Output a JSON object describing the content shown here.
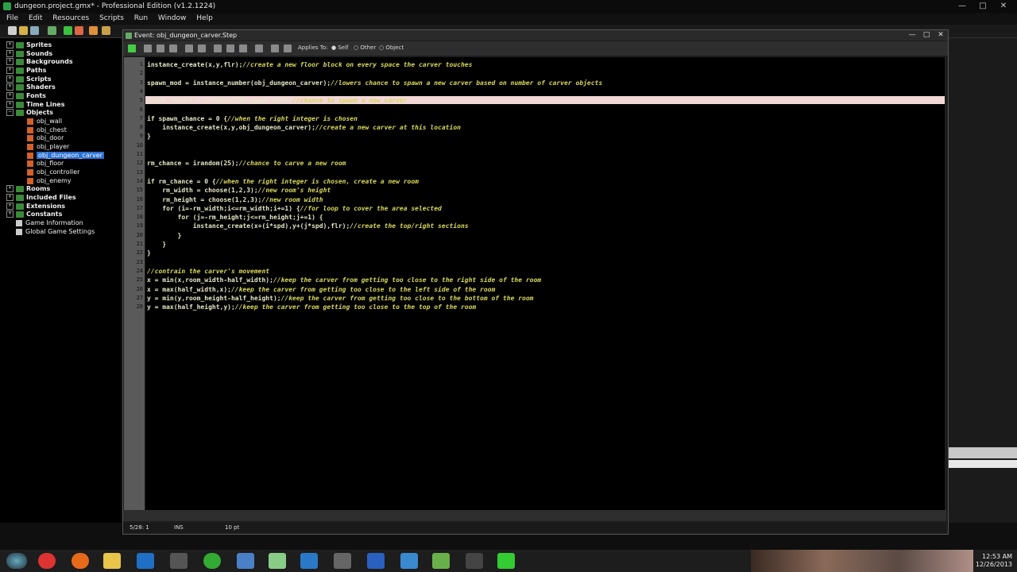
{
  "app": {
    "title": "dungeon.project.gmx* - Professional Edition (v1.2.1224)"
  },
  "menu": [
    "File",
    "Edit",
    "Resources",
    "Scripts",
    "Run",
    "Window",
    "Help"
  ],
  "tree": {
    "groups": [
      {
        "label": "Sprites"
      },
      {
        "label": "Sounds"
      },
      {
        "label": "Backgrounds"
      },
      {
        "label": "Paths"
      },
      {
        "label": "Scripts"
      },
      {
        "label": "Shaders"
      },
      {
        "label": "Fonts"
      },
      {
        "label": "Time Lines"
      },
      {
        "label": "Objects"
      }
    ],
    "objects": [
      "obj_wall",
      "obj_chest",
      "obj_door",
      "obj_player",
      "obj_dungeon_carver",
      "obj_floor",
      "obj_controller",
      "obj_enemy"
    ],
    "groups_after": [
      "Rooms",
      "Included Files",
      "Extensions",
      "Constants"
    ],
    "items_after": [
      "Game Information",
      "Global Game Settings"
    ]
  },
  "editor": {
    "title": "Event: obj_dungeon_carver.Step",
    "applies_label": "Applies To:",
    "opt_self": "Self",
    "opt_other": "Other",
    "opt_object": "Object",
    "status_pos": "5/28: 1",
    "status_mode": "INS",
    "status_font": "10 pt"
  },
  "code": [
    {
      "n": "1",
      "t": "instance_create(x,y,flr);//create a new floor block on every space the carver touches"
    },
    {
      "n": "2",
      "t": ""
    },
    {
      "n": "3",
      "t": "spawn_mod = instance_number(obj_dungeon_carver);//lowers chance to spawn a new carver based on number of carver objects"
    },
    {
      "n": "4",
      "t": ""
    },
    {
      "n": "5",
      "t": "spawn_chance = irandom(100-spawn_mod);//chance to spawn a new carver"
    },
    {
      "n": "6",
      "t": ""
    },
    {
      "n": "7",
      "t": "if spawn_chance = 0 {//when the right integer is chosen"
    },
    {
      "n": "8",
      "t": "    instance_create(x,y,obj_dungeon_carver);//create a new carver at this location"
    },
    {
      "n": "9",
      "t": "}"
    },
    {
      "n": "10",
      "t": ""
    },
    {
      "n": "11",
      "t": ""
    },
    {
      "n": "12",
      "t": "rm_chance = irandom(25);//chance to carve a new room"
    },
    {
      "n": "13",
      "t": ""
    },
    {
      "n": "14",
      "t": "if rm_chance = 0 {//when the right integer is chosen, create a new room"
    },
    {
      "n": "15",
      "t": "    rm_width = choose(1,2,3);//new room's height"
    },
    {
      "n": "16",
      "t": "    rm_height = choose(1,2,3);//new room width"
    },
    {
      "n": "17",
      "t": "    for (i=-rm_width;i<=rm_width;i+=1) {//for loop to cover the area selected"
    },
    {
      "n": "18",
      "t": "        for (j=-rm_height;j<=rm_height;j+=1) {"
    },
    {
      "n": "19",
      "t": "            instance_create(x+(i*spd),y+(j*spd),flr);//create the top/right sections"
    },
    {
      "n": "20",
      "t": "        }"
    },
    {
      "n": "21",
      "t": "    }"
    },
    {
      "n": "22",
      "t": "}"
    },
    {
      "n": "23",
      "t": ""
    },
    {
      "n": "24",
      "t": "//contrain the carver's movement"
    },
    {
      "n": "25",
      "t": "x = min(x,room_width-half_width);//keep the carver from getting too close to the right side of the room"
    },
    {
      "n": "26",
      "t": "x = max(half_width,x);//keep the carver from getting too close to the left side of the room"
    },
    {
      "n": "27",
      "t": "y = min(y,room_height-half_height);//keep the carver from getting too close to the bottom of the room"
    },
    {
      "n": "28",
      "t": "y = max(half_height,y);//keep the carver from getting too close to the top of the room"
    }
  ],
  "clock": {
    "time": "12:53 AM",
    "date": "12/26/2013"
  },
  "colors": {
    "accent": "#2a6fd0",
    "highlight_line": "#f3d7d7",
    "comment": "#d8d85a",
    "function": "#ffa02e"
  }
}
